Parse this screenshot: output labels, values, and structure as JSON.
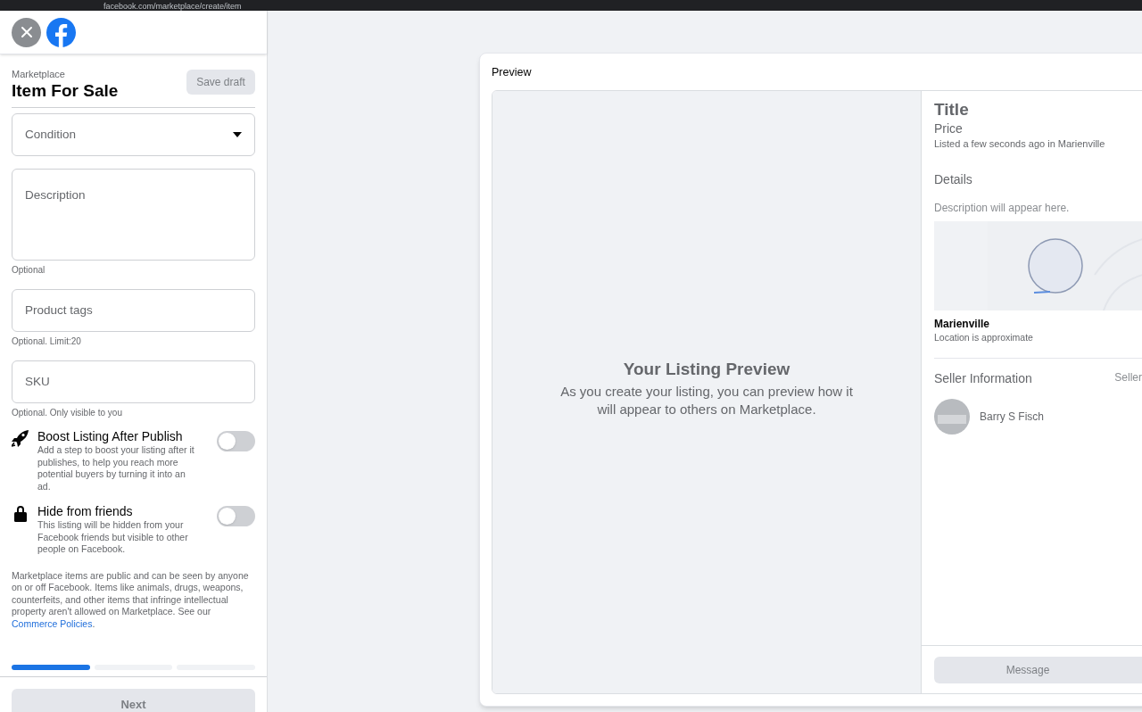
{
  "browser": {
    "url": "facebook.com/marketplace/create/item"
  },
  "form": {
    "section": "Marketplace",
    "title": "Item For Sale",
    "save_button": "Save draft",
    "fields": [
      {
        "kind": "select",
        "placeholder": "Condition"
      },
      {
        "kind": "textarea",
        "placeholder": "Description",
        "hint": "Optional"
      },
      {
        "kind": "input",
        "placeholder": "Product tags",
        "hint": "Optional. Limit:20"
      },
      {
        "kind": "input",
        "placeholder": "SKU",
        "hint": "Optional. Only visible to you"
      }
    ],
    "options": [
      {
        "kind": "rocket",
        "title": "Boost Listing After Publish",
        "description": "Add a step to boost your listing after it publishes, to help you reach more potential buyers by turning it into an ad.",
        "on": false
      },
      {
        "kind": "lock",
        "title": "Hide from friends",
        "description": "This listing will be hidden from your Facebook friends but visible to other people on Facebook.",
        "on": false
      }
    ],
    "disclaimer": "Marketplace items are public and can be seen by anyone on or off Facebook. Items like animals, drugs, weapons, counterfeits, and other items that infringe intellectual property aren't allowed on Marketplace. See our",
    "policy_link": "Commerce Policies",
    "disclaimer_end": ".",
    "steps": [
      {
        "complete": true
      },
      {
        "complete": false
      },
      {
        "complete": false
      }
    ],
    "next_button": "Next"
  },
  "preview": {
    "heading": "Preview",
    "placeholder_title": "Your Listing Preview",
    "placeholder_text": "As you create your listing, you can preview how it will appear to others on Marketplace.",
    "title": "Title",
    "price": "Price",
    "listed": "Listed a few seconds ago in Marienville",
    "details_heading": "Details",
    "description": "Description will appear here.",
    "location": "Marienville",
    "location_note": "Location is approximate",
    "seller_heading": "Seller Information",
    "seller_link": "Seller",
    "seller_name": "Barry S Fisch",
    "message_button": "Message"
  }
}
